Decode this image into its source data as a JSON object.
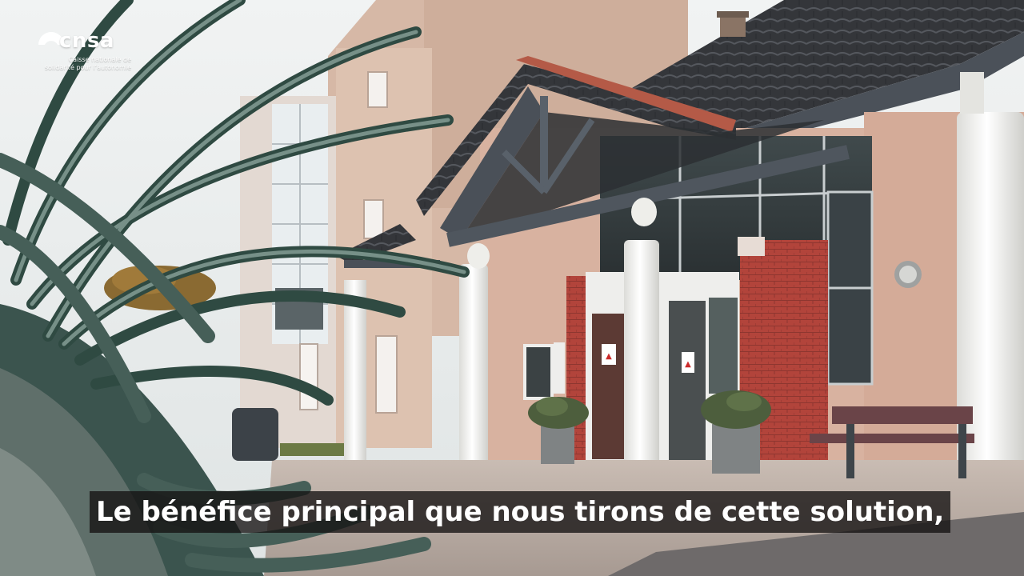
{
  "logo": {
    "word": "cnsa",
    "tagline_line1": "Caisse nationale de",
    "tagline_line2": "solidarité pour l’autonomie"
  },
  "subtitle": "Le bénéfice principal que nous tirons de cette solution,",
  "signs": {
    "door_sign": "▲",
    "window_sign": "▲"
  },
  "colors": {
    "sky": "#e8ecec",
    "render_wall": "#d9b6a3",
    "brick": "#b3423a",
    "roof_tiles": "#3c3e42",
    "timber": "#4a5058",
    "column": "#f2f2f0",
    "ground": "#b8aca4",
    "palm": "#3c5a52"
  }
}
